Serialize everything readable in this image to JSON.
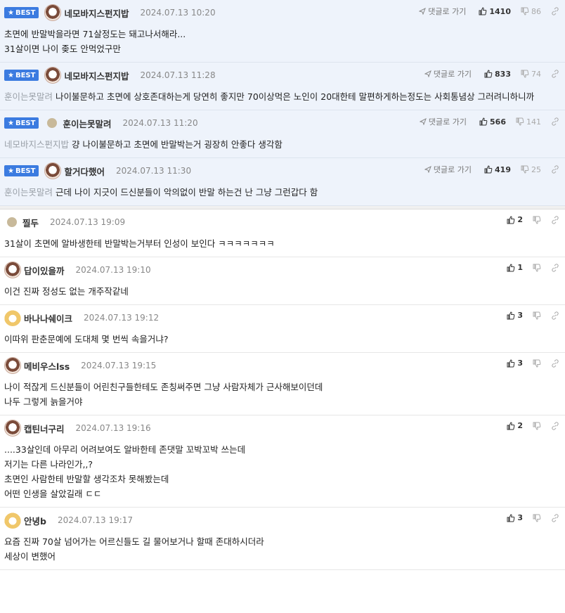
{
  "best_label": "BEST",
  "reply_label": "댓글로 가기",
  "best_comments": [
    {
      "nick": "네모바지스펀지밥",
      "avatar": "dog",
      "date": "2024.07.13 10:20",
      "likes": "1410",
      "dislikes": "86",
      "mention": "",
      "text": "초면에 반말박을라면 71살정도는 돼고나서해라...\n31살이면 나이 좆도 안먹었구만"
    },
    {
      "nick": "네모바지스펀지밥",
      "avatar": "dog",
      "date": "2024.07.13 11:28",
      "likes": "833",
      "dislikes": "74",
      "mention": "훈이는못말려",
      "text": "나이불문하고 초면에 상호존대하는게 당연히 좋지만 70이상먹은 노인이 20대한테 말편하게하는정도는 사회통념상 그러려니하니까"
    },
    {
      "nick": "훈이는못말려",
      "avatar": "dot",
      "date": "2024.07.13 11:20",
      "likes": "566",
      "dislikes": "141",
      "mention": "네모바지스펀지밥",
      "text": "걍 나이불문하고 초면에 반말박는거 굉장히 안좋다 생각함"
    },
    {
      "nick": "할거다했어",
      "avatar": "dog",
      "date": "2024.07.13 11:30",
      "likes": "419",
      "dislikes": "25",
      "mention": "훈이는못말려",
      "text": "근데 나이 지긋이 드신분들이 악의없이 반말 하는건 난 그냥 그런갑다 함"
    }
  ],
  "comments": [
    {
      "nick": "찔두",
      "avatar": "dot",
      "date": "2024.07.13 19:09",
      "likes": "2",
      "text": "31살이 초면에 알바생한테 반말박는거부터 인성이 보인다 ㅋㅋㅋㅋㅋㅋㅋ"
    },
    {
      "nick": "답이있을까",
      "avatar": "dog",
      "date": "2024.07.13 19:10",
      "likes": "1",
      "text": "이건 진짜 정성도 없는 개주작같네"
    },
    {
      "nick": "바나나쉐이크",
      "avatar": "cat",
      "date": "2024.07.13 19:12",
      "likes": "3",
      "text": "이따위 판춘문예에 도대체 몇 번씩 속을거냐?"
    },
    {
      "nick": "메비우스lss",
      "avatar": "dog",
      "date": "2024.07.13 19:15",
      "likes": "3",
      "text": "나이 적잖게 드신분들이 어린친구들한테도 존칭써주면 그냥 사람자체가 근사해보이던데\n나두 그렇게 늙을거야"
    },
    {
      "nick": "캡틴너구리",
      "avatar": "dog",
      "date": "2024.07.13 19:16",
      "likes": "2",
      "text": "....33살인데 아무리 어려보여도 알바한테 존댓말 꼬박꼬박 쓰는데\n저기는 다른 나라인가,,?\n초면인 사람한테 반말할 생각조차 못해봤는데\n어떤 인생을 살았길래 ㄷㄷ"
    },
    {
      "nick": "안녕b",
      "avatar": "cat",
      "date": "2024.07.13 19:17",
      "likes": "3",
      "text": "요즘 진짜 70살 넘어가는 어르신들도 길 물어보거나 할때 존대하시더라\n세상이 변했어"
    }
  ]
}
